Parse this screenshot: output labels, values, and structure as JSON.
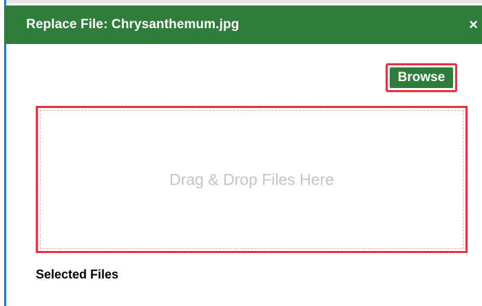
{
  "dialog": {
    "title": "Replace File: Chrysanthemum.jpg",
    "close_label": "×"
  },
  "toolbar": {
    "browse_label": "Browse"
  },
  "dropzone": {
    "placeholder": "Drag & Drop Files Here"
  },
  "selected_files": {
    "heading": "Selected Files"
  },
  "colors": {
    "titlebar": "#2e7d3b",
    "highlight": "#e8333e",
    "placeholder_text": "#c4c4c4"
  },
  "icons": {
    "close": "close-icon"
  }
}
